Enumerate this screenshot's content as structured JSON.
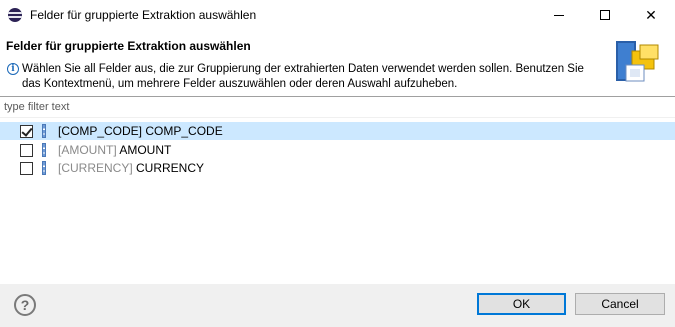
{
  "window": {
    "title": "Felder für gruppierte Extraktion auswählen",
    "controls": {
      "minimize": "minimize-icon",
      "maximize": "maximize-icon",
      "close_symbol": "✕"
    }
  },
  "header": {
    "title": "Felder für gruppierte Extraktion auswählen",
    "info_symbol": "i",
    "message": "Wählen Sie all Felder aus, die zur Gruppierung der extrahierten Daten verwendet werden sollen. Benutzen Sie das Kontextmenü, um mehrere Felder auszuwählen oder deren Auswahl aufzuheben."
  },
  "filter": {
    "placeholder": "type filter text",
    "value": ""
  },
  "fields": [
    {
      "tech": "[COMP_CODE]",
      "name": "COMP_CODE",
      "checked": true,
      "selected": true,
      "dim": false
    },
    {
      "tech": "[AMOUNT]",
      "name": "AMOUNT",
      "checked": false,
      "selected": false,
      "dim": true
    },
    {
      "tech": "[CURRENCY]",
      "name": "CURRENCY",
      "checked": false,
      "selected": false,
      "dim": true
    }
  ],
  "footer": {
    "help_symbol": "?",
    "ok_label": "OK",
    "cancel_label": "Cancel"
  },
  "colors": {
    "selection": "#cce8ff",
    "accent": "#0078d7",
    "field_icon": "#6f9bd6"
  }
}
